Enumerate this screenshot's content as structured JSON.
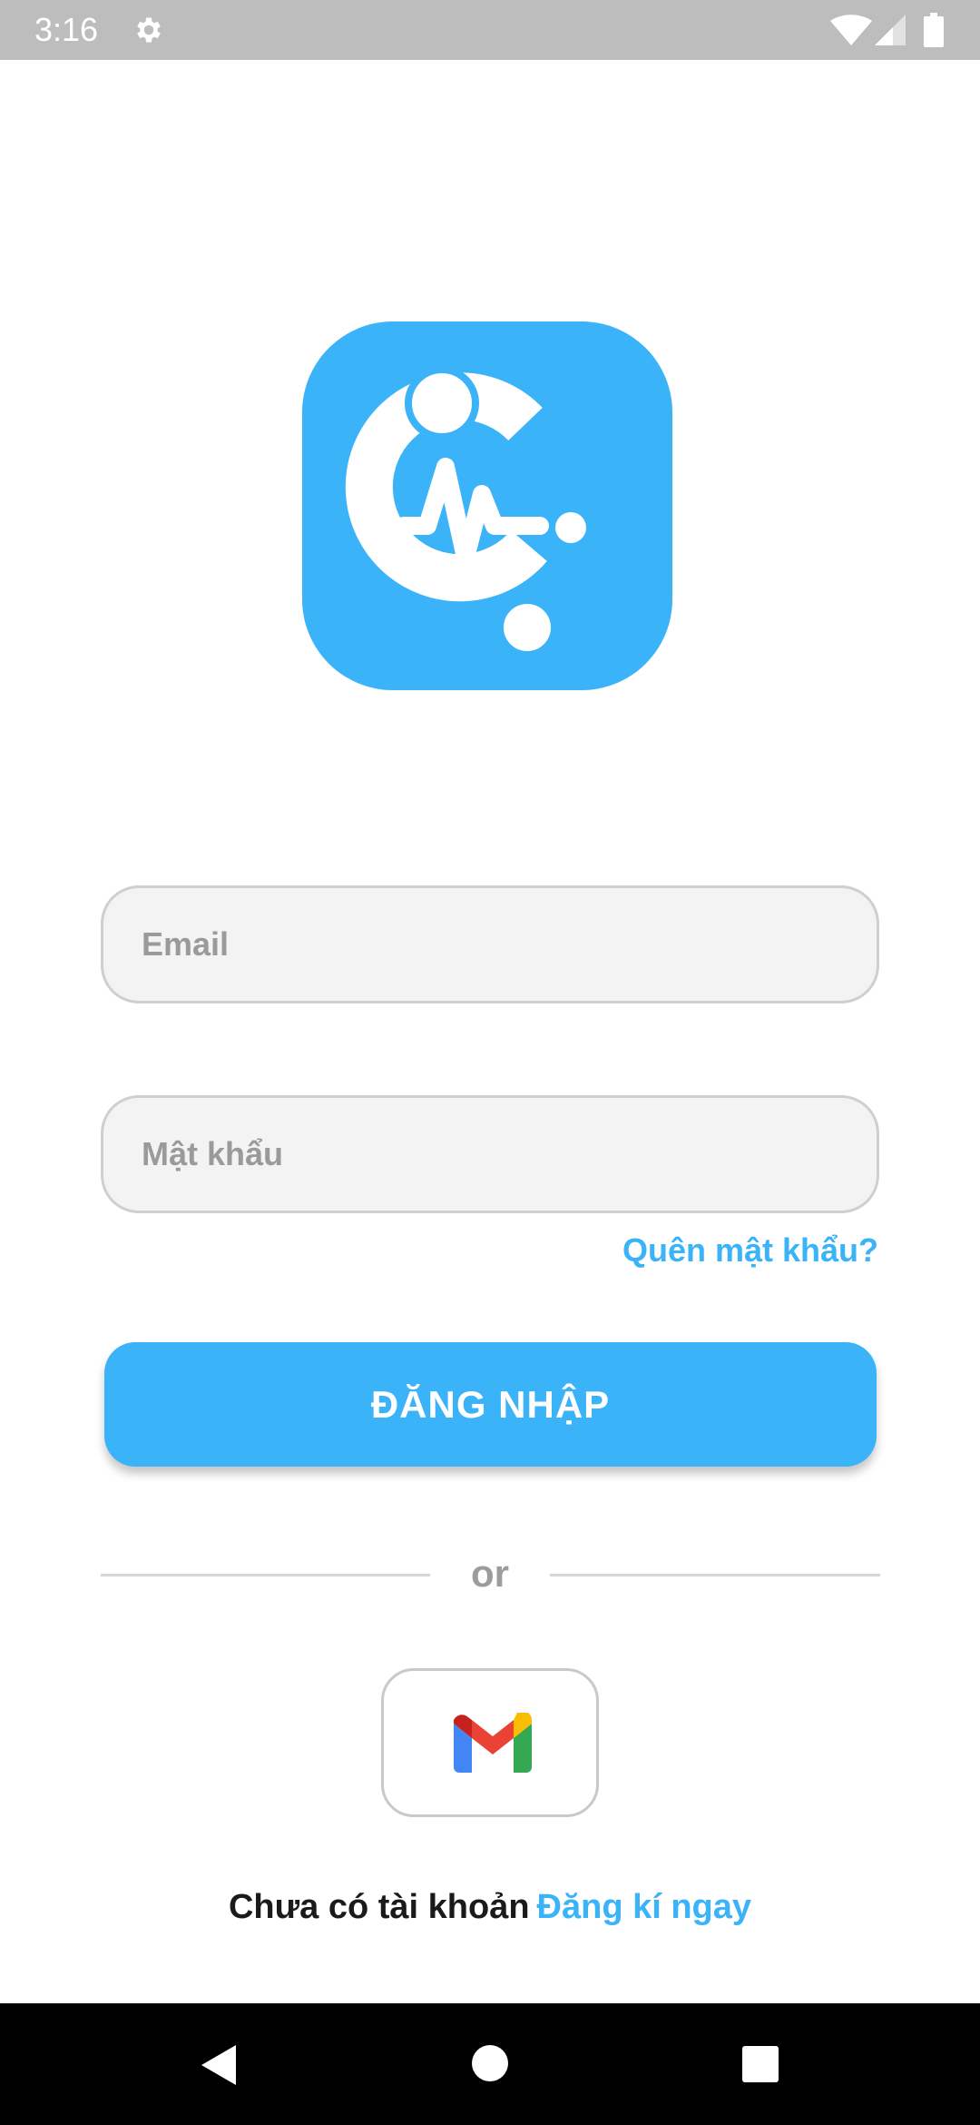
{
  "status_bar": {
    "time": "3:16",
    "icons": [
      "gear-icon",
      "wifi-icon",
      "signal-icon",
      "battery-icon"
    ]
  },
  "logo": {
    "icon": "heartbeat-logo-icon",
    "background_color": "#3bb3f8"
  },
  "form": {
    "email_placeholder": "Email",
    "email_value": "",
    "password_placeholder": "Mật khẩu",
    "password_value": "",
    "forgot_password": "Quên mật khẩu?",
    "login_label": "ĐĂNG NHẬP"
  },
  "divider": {
    "text": "or"
  },
  "social": {
    "gmail_icon": "gmail-icon"
  },
  "signup": {
    "prompt": "Chưa có tài khoản",
    "link": "Đăng kí ngay"
  },
  "nav_bar": {
    "icons": [
      "back-icon",
      "home-icon",
      "recents-icon"
    ]
  },
  "colors": {
    "accent": "#3bb3f8",
    "status_bar": "#bdbdbd",
    "nav_bar": "#000000",
    "field_background": "#f3f3f3"
  }
}
